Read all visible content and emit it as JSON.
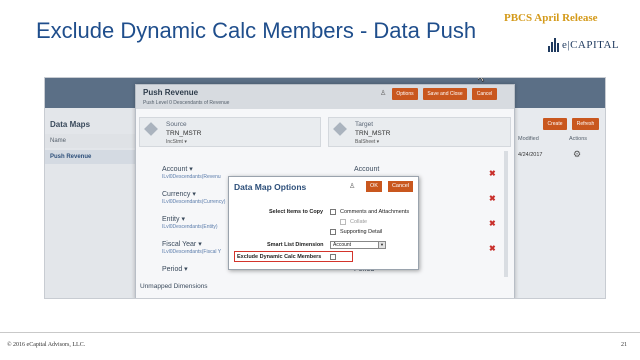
{
  "slide": {
    "title": "Exclude Dynamic Calc Members - Data Push",
    "release": "PBCS April Release",
    "logo_text": "e|CAPITAL",
    "footer_copyright": "© 2016 eCapital Advisors, LLC.",
    "page_number": "21"
  },
  "data_maps": {
    "title": "Data Maps",
    "col_name": "Name",
    "item": "Push Revenue"
  },
  "right_panel": {
    "create": "Create",
    "refresh": "Refresh",
    "col_modified": "Modified",
    "col_actions": "Actions",
    "date": "4/24/2017"
  },
  "push": {
    "title": "Push Revenue",
    "subtitle": "Push Level 0 Descendants of Revenue",
    "options": "Options",
    "save_close": "Save and Close",
    "cancel": "Cancel",
    "source_label": "Source",
    "source_app": "TRN_MSTR",
    "source_cube": "IncStmt",
    "target_label": "Target",
    "target_app": "TRN_MSTR",
    "target_cube": "BalSheet",
    "dims": [
      {
        "name": "Account",
        "value": "ILvl0Descendants(Revenu",
        "target": "Account"
      },
      {
        "name": "Currency",
        "value": "ILvl0Descendants(Currency)",
        "target": ""
      },
      {
        "name": "Entity",
        "value": "ILvl0Descendants(Entity)",
        "target": ""
      },
      {
        "name": "Fiscal Year",
        "value": "ILvl0Descendants(Fiscal Y",
        "target": ""
      },
      {
        "name": "Period",
        "value": "",
        "target": "Period"
      }
    ],
    "unmapped": "Unmapped Dimensions"
  },
  "dialog": {
    "title": "Data Map Options",
    "ok": "OK",
    "cancel": "Cancel",
    "select_items_label": "Select Items to Copy",
    "comments": "Comments and Attachments",
    "collate": "Collate",
    "supporting": "Supporting Detail",
    "smart_list_label": "Smart List Dimension",
    "smart_list_value": "Account",
    "exclude_label": "Exclude Dynamic Calc Members"
  },
  "colors": {
    "title_blue": "#1f4e8c",
    "release_gold": "#d49a1a",
    "orange_button": "#c9571e",
    "highlight_red": "#d3342b"
  }
}
